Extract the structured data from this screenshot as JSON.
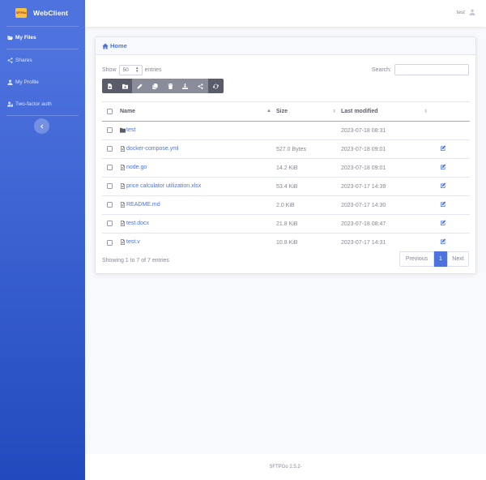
{
  "brand": {
    "logo_text": "SFTPGo",
    "name": "WebClient"
  },
  "sidebar": {
    "items": [
      {
        "label": "My Files",
        "icon": "folder-open-icon",
        "active": true
      },
      {
        "label": "Shares",
        "icon": "share-icon",
        "active": false
      },
      {
        "label": "My Profile",
        "icon": "user-icon",
        "active": false
      },
      {
        "label": "Two-factor auth",
        "icon": "user-lock-icon",
        "active": false
      }
    ],
    "toggle_icon": "chevron-left-icon"
  },
  "topbar": {
    "username": "test",
    "avatar_icon": "user-icon"
  },
  "breadcrumb": {
    "label": "Home",
    "icon": "home-icon"
  },
  "table_controls": {
    "show_label": "Show",
    "entries_value": "50",
    "entries_label": "entries",
    "search_label": "Search:",
    "search_value": ""
  },
  "toolbar": [
    {
      "name": "add-file",
      "icon": "file-add-icon"
    },
    {
      "name": "add-folder",
      "icon": "folder-add-icon"
    },
    {
      "name": "rename",
      "icon": "pencil-icon"
    },
    {
      "name": "copy",
      "icon": "copy-icon"
    },
    {
      "name": "delete",
      "icon": "trash-icon"
    },
    {
      "name": "download",
      "icon": "download-icon"
    },
    {
      "name": "share",
      "icon": "share-icon"
    },
    {
      "name": "refresh",
      "icon": "refresh-icon"
    }
  ],
  "files": {
    "columns": [
      "Name",
      "Size",
      "Last modified"
    ],
    "rows": [
      {
        "name": "test",
        "type": "folder",
        "size": "",
        "modified": "2023-07-18 08:31",
        "editable": false
      },
      {
        "name": "docker-compose.yml",
        "type": "file",
        "size": "527.0 Bytes",
        "modified": "2023-07-18 09:01",
        "editable": true
      },
      {
        "name": "node.go",
        "type": "file",
        "size": "14.2 KiB",
        "modified": "2023-07-18 09:01",
        "editable": true
      },
      {
        "name": "price calculator utilization.xlsx",
        "type": "file",
        "size": "53.4 KiB",
        "modified": "2023-07-17 14:39",
        "editable": true
      },
      {
        "name": "README.md",
        "type": "file",
        "size": "2.0 KiB",
        "modified": "2023-07-17 14:30",
        "editable": true
      },
      {
        "name": "test.docx",
        "type": "file",
        "size": "21.8 KiB",
        "modified": "2023-07-18 08:47",
        "editable": true
      },
      {
        "name": "test.v",
        "type": "file",
        "size": "10.8 KiB",
        "modified": "2023-07-17 14:31",
        "editable": true
      }
    ]
  },
  "pagination": {
    "info": "Showing 1 to 7 of 7 entries",
    "previous": "Previous",
    "current": "1",
    "next": "Next"
  },
  "footer": {
    "text": "SFTPGo 2.5.2-"
  },
  "colors": {
    "primary": "#4e73df",
    "sidebar_end": "#224abe",
    "toolbar_dark": "#5a5c69"
  }
}
